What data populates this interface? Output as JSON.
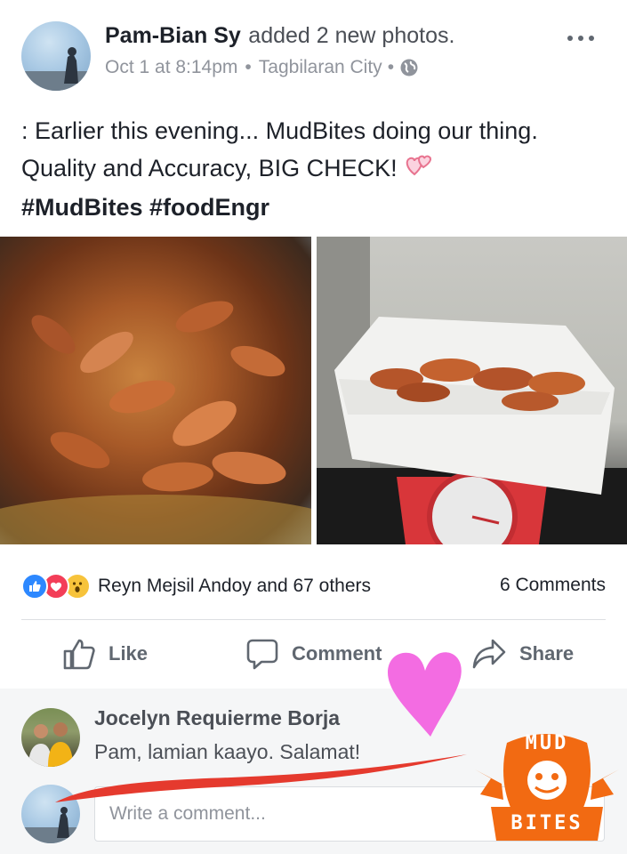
{
  "post": {
    "author": "Pam-Bian Sy",
    "action": "added 2 new photos.",
    "date": "Oct 1 at 8:14pm",
    "location": "Tagbilaran City",
    "text": ": Earlier this evening... MudBites doing our thing. Quality and Accuracy, BIG CHECK!",
    "hashtags": "#MudBites #foodEngr"
  },
  "reactions": {
    "summary": "Reyn Mejsil Andoy and 67 others",
    "comments_count": "6 Comments"
  },
  "actions": {
    "like": "Like",
    "comment": "Comment",
    "share": "Share"
  },
  "comment": {
    "author": "Jocelyn Requierme Borja",
    "text": "Pam, lamian kaayo. Salamat!"
  },
  "composer": {
    "placeholder": "Write a comment..."
  },
  "logo": {
    "line1": "MUD",
    "line2": "BITES"
  }
}
